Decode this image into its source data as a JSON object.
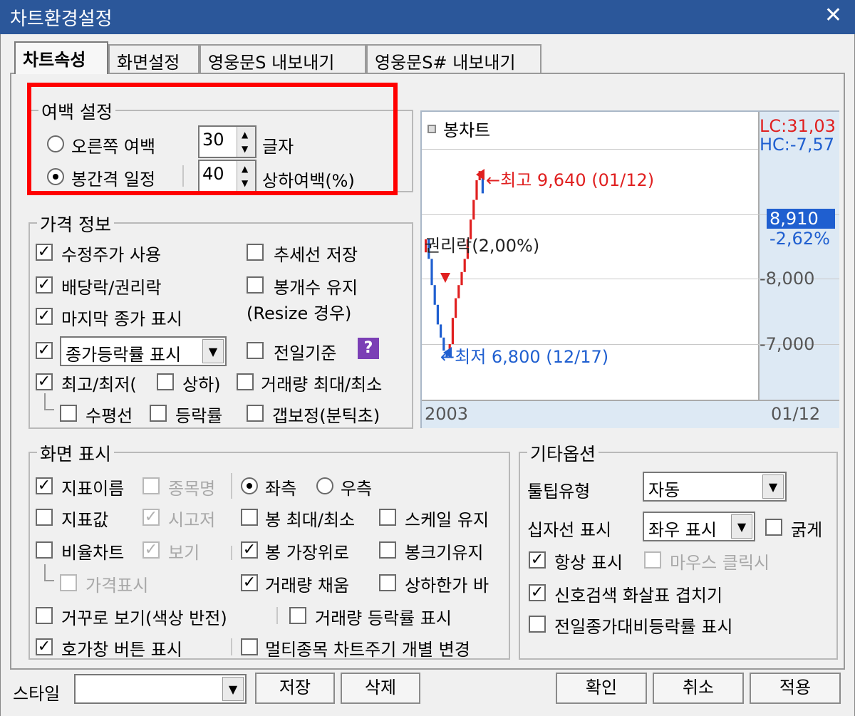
{
  "window": {
    "title": "차트환경설정",
    "close_glyph": "✕"
  },
  "tabs": [
    "차트속성",
    "화면설정",
    "영웅문S 내보내기",
    "영웅문S# 내보내기"
  ],
  "margin": {
    "title": "여백 설정",
    "right_margin_label": "오른쪽 여백",
    "right_margin_value": "30",
    "right_margin_unit": "글자",
    "candle_gap_label": "봉간격 일정",
    "candle_gap_value": "40",
    "candle_gap_unit": "상하여백(%)"
  },
  "price": {
    "title": "가격 정보",
    "adj_price": "수정주가 사용",
    "trend_save": "추세선 저장",
    "dividend": "배당락/권리락",
    "keep_count": "봉개수 유지",
    "keep_count_note": "(Resize 경우)",
    "last_close": "마지막 종가 표시",
    "close_combo": "종가등락률 표시",
    "prev_day": "전일기준",
    "help": "?",
    "high_low": "최고/최저(",
    "updown": "상하)",
    "volume_maxmin": "거래량 최대/최소",
    "hline": "수평선",
    "rate": "등락률",
    "gap": "갭보정(분틱초)"
  },
  "chart": {
    "legend": "봉차트",
    "lc": "LC:31,03",
    "hc": "HC:-7,57",
    "high_label": "←최고 9,640 (01/12)",
    "low_label": "←최저 6,800 (12/17)",
    "rights_label": "권리락(2,00%)",
    "price_tag": "8,910",
    "pct_tag": "-2,62%",
    "tick_8000": "-8,000",
    "tick_7000": "-7,000",
    "year": "2003",
    "date": "01/12"
  },
  "chart_data": {
    "type": "candlestick",
    "y_ticks": [
      7000,
      8000
    ],
    "high": {
      "value": 9640,
      "date": "01/12"
    },
    "low": {
      "value": 6800,
      "date": "12/17"
    },
    "current": 8910,
    "change_pct": -2.62
  },
  "screen": {
    "title": "화면 표시",
    "ind_name": "지표이름",
    "stock_name": "종목명",
    "left": "좌측",
    "right": "우측",
    "ind_value": "지표값",
    "sigoje": "시고저",
    "candle_maxmin": "봉 최대/최소",
    "keep_scale": "스케일 유지",
    "ratio_chart": "비율차트",
    "view": "보기",
    "candle_top": "봉 가장위로",
    "keep_size": "봉크기유지",
    "price_disp": "가격표시",
    "vol_fill": "거래량 채움",
    "limit_bar": "상하한가 바",
    "reverse": "거꾸로 보기(색상 반전)",
    "vol_rate": "거래량 등락률 표시",
    "hoga_btn": "호가창 버튼 표시",
    "multi": "멀티종목 차트주기 개별 변경"
  },
  "etc": {
    "title": "기타옵션",
    "tooltip_label": "툴팁유형",
    "tooltip_value": "자동",
    "cross_label": "십자선 표시",
    "cross_value": "좌우 표시",
    "bold": "굵게",
    "always": "항상 표시",
    "mouse_click": "마우스 클릭시",
    "signal_arrow": "신호검색 화살표 겹치기",
    "prev_close_rate": "전일종가대비등락률 표시"
  },
  "footer": {
    "style_label": "스타일",
    "style_value": "",
    "save": "저장",
    "delete": "삭제",
    "ok": "확인",
    "cancel": "취소",
    "apply": "적용"
  },
  "colors": {
    "titlebar": "#2b579a",
    "highlight": "#ff0000",
    "up": "#e02020",
    "down": "#1f5fd0",
    "price_tag": "#1f5fd0"
  }
}
